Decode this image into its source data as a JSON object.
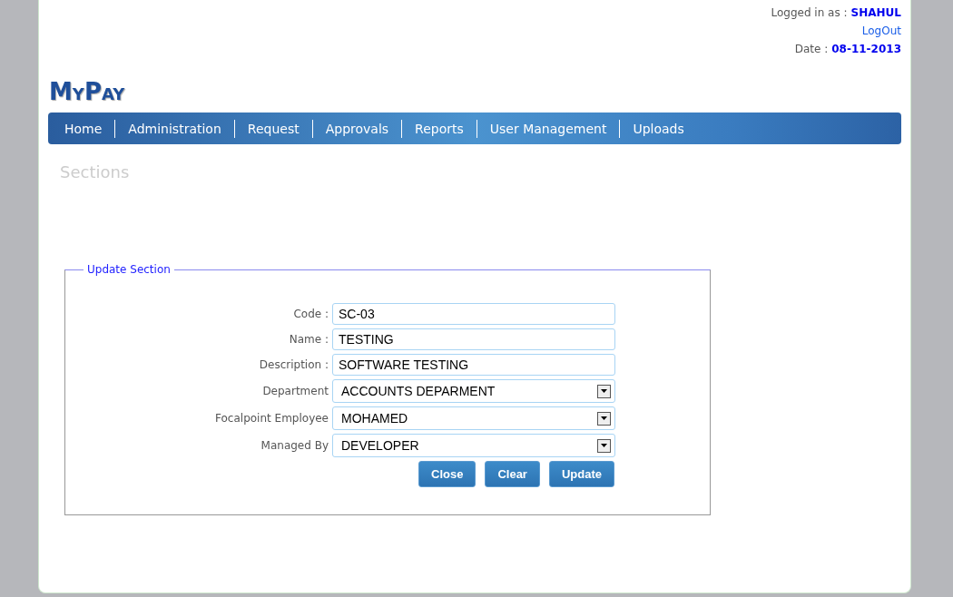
{
  "header": {
    "logged_in_label": "Logged in as :",
    "user": "SHAHUL",
    "logout": "LogOut",
    "date_label": "Date :",
    "date": "08-11-2013"
  },
  "logo": "MyPay",
  "nav": [
    {
      "label": "Home"
    },
    {
      "label": "Administration"
    },
    {
      "label": "Request"
    },
    {
      "label": "Approvals"
    },
    {
      "label": "Reports"
    },
    {
      "label": "User Management"
    },
    {
      "label": "Uploads"
    }
  ],
  "page_title": "Sections",
  "form": {
    "legend": "Update Section",
    "fields": [
      {
        "label": "Code :",
        "kind": "text",
        "value": "SC-03"
      },
      {
        "label": "Name :",
        "kind": "text",
        "value": "TESTING"
      },
      {
        "label": "Description :",
        "kind": "text",
        "value": "SOFTWARE TESTING"
      },
      {
        "label": "Department",
        "kind": "select",
        "value": "ACCOUNTS DEPARMENT"
      },
      {
        "label": "Focalpoint Employee",
        "kind": "select",
        "value": "MOHAMED"
      },
      {
        "label": "Managed By",
        "kind": "select",
        "value": "DEVELOPER"
      }
    ],
    "buttons": [
      "Close",
      "Clear",
      "Update"
    ]
  }
}
